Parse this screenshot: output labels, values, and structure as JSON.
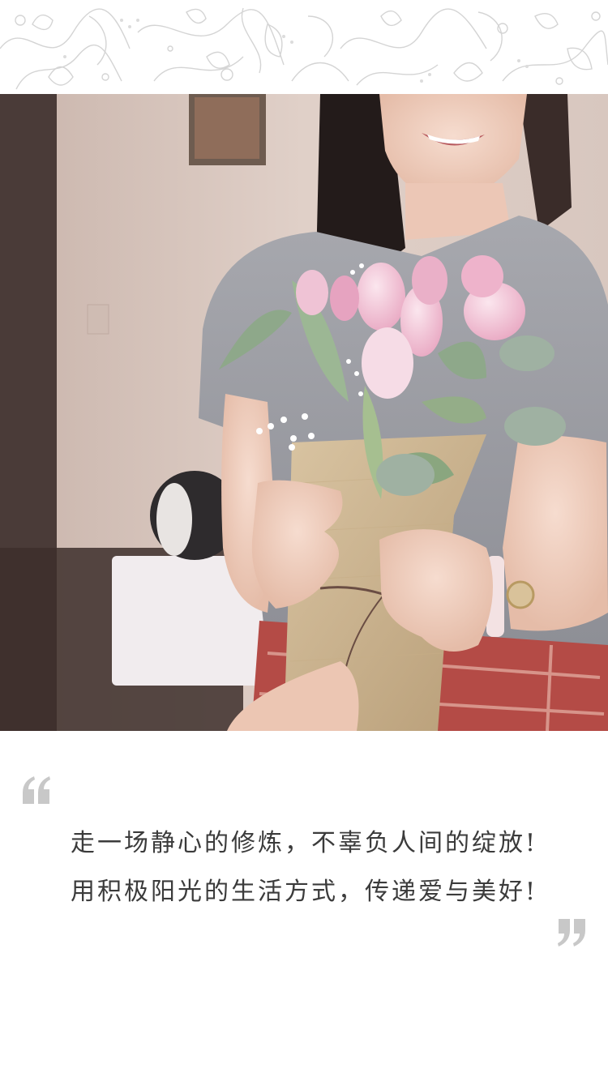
{
  "quote": {
    "line1": "走一场静心的修炼，不辜负人间的绽放!",
    "line2": "用积极阳光的生活方式，传递爱与美好!"
  },
  "icons": {
    "open_quote": "left-double-quote-icon",
    "close_quote": "right-double-quote-icon",
    "decoration": "floral-lace-pattern"
  },
  "colors": {
    "text": "#3b3b3b",
    "quote_mark": "#c8c8c8",
    "lace": "#cfcfcf",
    "background": "#ffffff"
  }
}
